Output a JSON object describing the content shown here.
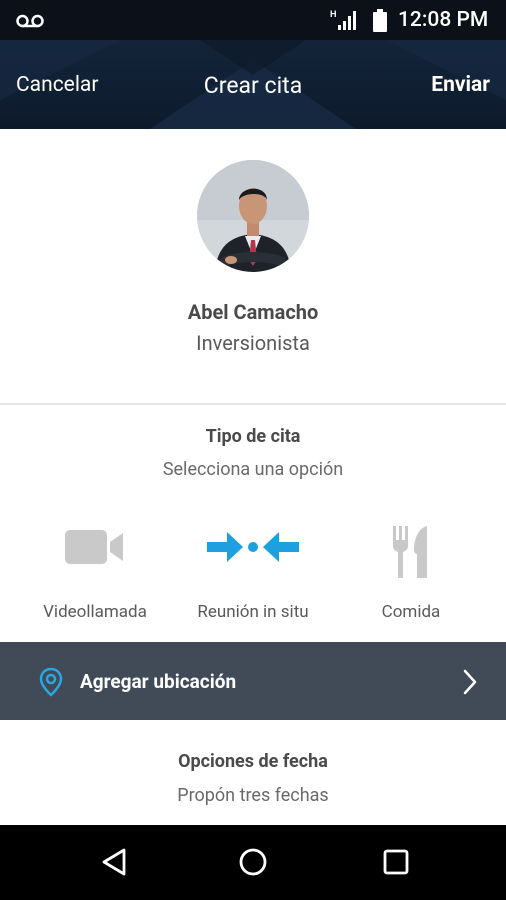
{
  "status_bar": {
    "time": "12:08 PM",
    "network_type": "H",
    "icons": [
      "voicemail-icon",
      "signal-icon",
      "battery-icon"
    ]
  },
  "app_bar": {
    "cancel_label": "Cancelar",
    "title": "Crear cita",
    "send_label": "Enviar"
  },
  "contact": {
    "name": "Abel Camacho",
    "role": "Inversionista"
  },
  "appointment_type": {
    "title": "Tipo de cita",
    "subtitle": "Selecciona una opción",
    "options": [
      {
        "label": "Videollamada",
        "icon": "video-camera-icon",
        "selected": false
      },
      {
        "label": "Reunión in situ",
        "icon": "meeting-arrows-icon",
        "selected": true
      },
      {
        "label": "Comida",
        "icon": "fork-knife-icon",
        "selected": false
      }
    ]
  },
  "location": {
    "label": "Agregar ubicación",
    "icon": "location-pin-icon"
  },
  "date_options": {
    "title": "Opciones de fecha",
    "subtitle": "Propón tres fechas"
  },
  "nav_bar": {
    "buttons": [
      "back-icon",
      "home-icon",
      "recents-icon"
    ]
  },
  "colors": {
    "accent": "#1e9fe0",
    "inactive_icon": "#c9c9c9",
    "header_bg": "#13243a",
    "location_bar_bg": "#414a57"
  }
}
